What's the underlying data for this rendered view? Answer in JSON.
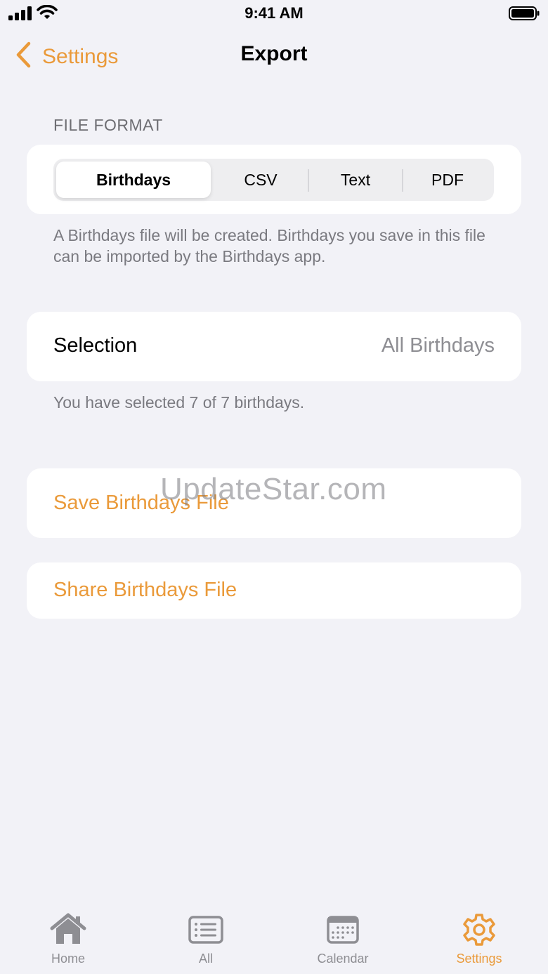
{
  "status_bar": {
    "time": "9:41 AM"
  },
  "nav": {
    "back_label": "Settings",
    "title": "Export"
  },
  "file_format": {
    "header": "FILE FORMAT",
    "options": [
      "Birthdays",
      "CSV",
      "Text",
      "PDF"
    ],
    "selected": "Birthdays",
    "description": "A Birthdays file will be created. Birthdays you save in this file can be imported by the Birthdays app."
  },
  "selection": {
    "label": "Selection",
    "value": "All Birthdays",
    "footer": "You have selected 7 of 7 birthdays."
  },
  "actions": {
    "save": "Save Birthdays File",
    "share": "Share Birthdays File"
  },
  "watermark": "UpdateStar.com",
  "tab_bar": {
    "items": [
      {
        "label": "Home",
        "icon": "house-icon"
      },
      {
        "label": "All",
        "icon": "list-icon"
      },
      {
        "label": "Calendar",
        "icon": "calendar-icon"
      },
      {
        "label": "Settings",
        "icon": "gear-icon"
      }
    ],
    "active": "Settings"
  },
  "colors": {
    "accent": "#ea9a3a",
    "background": "#f2f2f7",
    "secondary_text": "#8e8e93"
  }
}
